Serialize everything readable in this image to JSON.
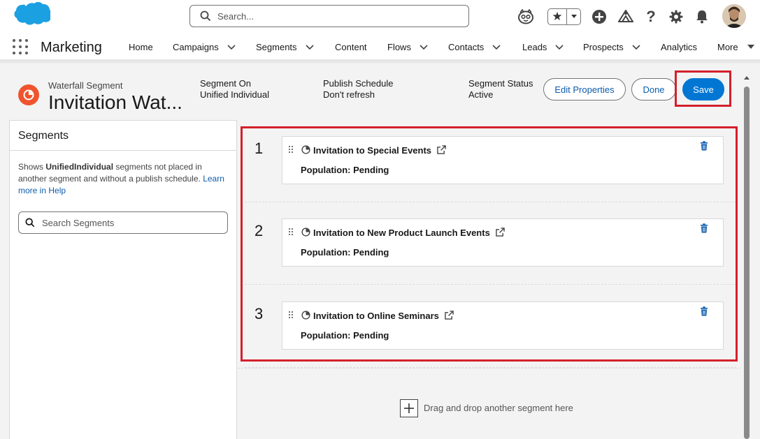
{
  "header": {
    "search_placeholder": "Search...",
    "icons": [
      "salesforce-logo",
      "einstein-icon",
      "favorites-star-icon",
      "add-icon",
      "trailhead-icon",
      "help-icon",
      "setup-gear-icon",
      "notifications-bell-icon",
      "user-avatar"
    ]
  },
  "nav": {
    "app_name": "Marketing",
    "items": [
      {
        "label": "Home",
        "has_menu": false
      },
      {
        "label": "Campaigns",
        "has_menu": true
      },
      {
        "label": "Segments",
        "has_menu": true
      },
      {
        "label": "Content",
        "has_menu": false
      },
      {
        "label": "Flows",
        "has_menu": true
      },
      {
        "label": "Contacts",
        "has_menu": true
      },
      {
        "label": "Leads",
        "has_menu": true
      },
      {
        "label": "Prospects",
        "has_menu": true
      },
      {
        "label": "Analytics",
        "has_menu": false
      },
      {
        "label": "More",
        "has_menu": true
      }
    ]
  },
  "record": {
    "type": "Waterfall Segment",
    "title": "Invitation Wat...",
    "fields": [
      {
        "label": "Segment On",
        "value": "Unified Individual"
      },
      {
        "label": "Publish Schedule",
        "value": "Don't refresh"
      },
      {
        "label": "Segment Status",
        "value": "Active"
      }
    ],
    "buttons": {
      "edit": "Edit Properties",
      "done": "Done",
      "save": "Save"
    }
  },
  "left_panel": {
    "title": "Segments",
    "help_prefix": "Shows ",
    "help_bold": "UnifiedIndividual",
    "help_middle": " segments not placed in another segment and without a publish schedule. ",
    "help_link": "Learn more in Help",
    "search_placeholder": "Search Segments"
  },
  "waterfall": {
    "slots": [
      {
        "number": "1",
        "name": "Invitation to Special Events",
        "population": "Population: Pending"
      },
      {
        "number": "2",
        "name": "Invitation to New Product Launch Events",
        "population": "Population: Pending"
      },
      {
        "number": "3",
        "name": "Invitation to Online Seminars",
        "population": "Population: Pending"
      }
    ],
    "drop_text": "Drag and drop another segment here"
  },
  "colors": {
    "brand": "#0176d3",
    "highlight": "#d4202c",
    "segment_icon": "#f0542e",
    "link": "#0b5cab"
  }
}
